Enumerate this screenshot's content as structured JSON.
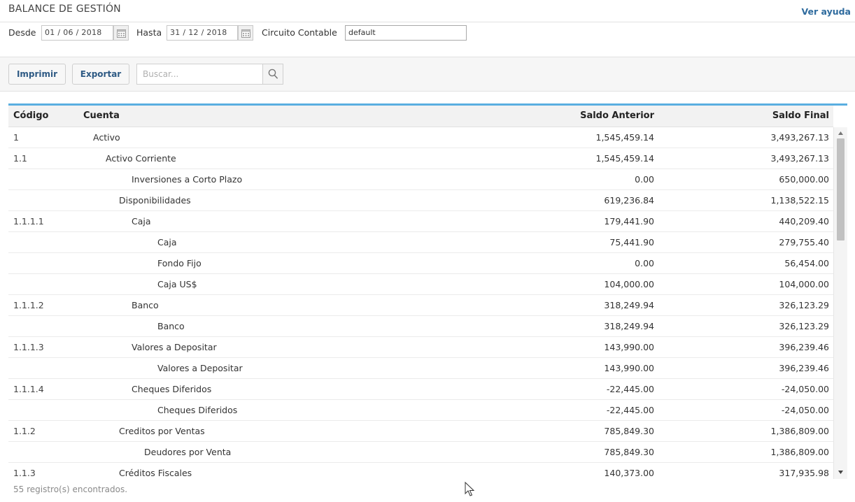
{
  "header": {
    "title": "BALANCE DE GESTIÓN",
    "help_link": "Ver ayuda"
  },
  "filters": {
    "from_label": "Desde",
    "from_value": "01 / 06 /  2018",
    "to_label": "Hasta",
    "to_value": "31 / 12 /  2018",
    "circuit_label": "Circuito Contable",
    "circuit_value": "default"
  },
  "toolbar": {
    "print_label": "Imprimir",
    "export_label": "Exportar",
    "search_placeholder": "Buscar..."
  },
  "table": {
    "columns": {
      "code": "Código",
      "account": "Cuenta",
      "prev": "Saldo Anterior",
      "final": "Saldo Final"
    },
    "rows": [
      {
        "code": "1",
        "account": "Activo",
        "level": 1,
        "prev": "1,545,459.14",
        "final": "3,493,267.13"
      },
      {
        "code": "1.1",
        "account": "Activo Corriente",
        "level": 2,
        "prev": "1,545,459.14",
        "final": "3,493,267.13"
      },
      {
        "code": "",
        "account": "Inversiones a Corto Plazo",
        "level": 4,
        "prev": "0.00",
        "final": "650,000.00"
      },
      {
        "code": "",
        "account": "Disponibilidades",
        "level": 3,
        "prev": "619,236.84",
        "final": "1,138,522.15"
      },
      {
        "code": "1.1.1.1",
        "account": "Caja",
        "level": 4,
        "prev": "179,441.90",
        "final": "440,209.40"
      },
      {
        "code": "",
        "account": "Caja",
        "level": 5,
        "prev": "75,441.90",
        "final": "279,755.40"
      },
      {
        "code": "",
        "account": "Fondo Fijo",
        "level": 5,
        "prev": "0.00",
        "final": "56,454.00"
      },
      {
        "code": "",
        "account": "Caja US$",
        "level": 5,
        "prev": "104,000.00",
        "final": "104,000.00"
      },
      {
        "code": "1.1.1.2",
        "account": "Banco",
        "level": 4,
        "prev": "318,249.94",
        "final": "326,123.29"
      },
      {
        "code": "",
        "account": "Banco",
        "level": 5,
        "prev": "318,249.94",
        "final": "326,123.29"
      },
      {
        "code": "1.1.1.3",
        "account": "Valores a Depositar",
        "level": 4,
        "prev": "143,990.00",
        "final": "396,239.46"
      },
      {
        "code": "",
        "account": "Valores a Depositar",
        "level": 5,
        "prev": "143,990.00",
        "final": "396,239.46"
      },
      {
        "code": "1.1.1.4",
        "account": "Cheques Diferidos",
        "level": 4,
        "prev": "-22,445.00",
        "final": "-24,050.00"
      },
      {
        "code": "",
        "account": "Cheques Diferidos",
        "level": 5,
        "prev": "-22,445.00",
        "final": "-24,050.00"
      },
      {
        "code": "1.1.2",
        "account": "Creditos por Ventas",
        "level": 3,
        "prev": "785,849.30",
        "final": "1,386,809.00"
      },
      {
        "code": "",
        "account": "Deudores por Venta",
        "level": 4.5,
        "prev": "785,849.30",
        "final": "1,386,809.00"
      },
      {
        "code": "1.1.3",
        "account": "Créditos Fiscales",
        "level": 3,
        "prev": "140,373.00",
        "final": "317,935.98"
      }
    ]
  },
  "footer": {
    "status": "55 registro(s) encontrados."
  }
}
